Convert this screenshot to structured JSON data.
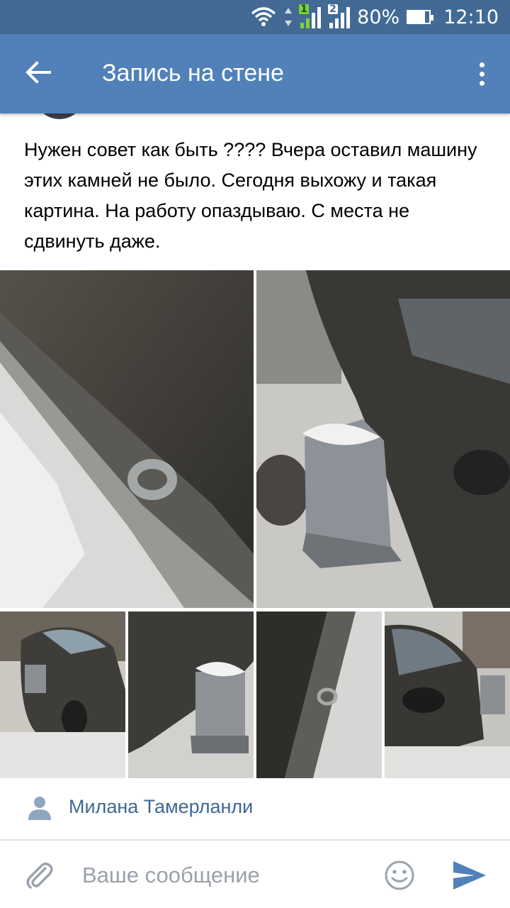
{
  "status_bar": {
    "sim1_label": "1",
    "sim2_label": "2",
    "battery": "80%",
    "time": "12:10"
  },
  "toolbar": {
    "title": "Запись на стене",
    "back_icon": "arrow-back-icon",
    "more_icon": "more-vertical-icon"
  },
  "post": {
    "text": "Нужен совет как быть ???? Вчера оставил машину этих камней не было. Сегодня выхожу и такая картина. На работу опаздываю. С места не сдвинуть даже.",
    "photos_count": 6
  },
  "author": {
    "name": "Милана Тамерланли",
    "icon": "person-icon"
  },
  "composer": {
    "placeholder": "Ваше сообщение",
    "attach_icon": "paperclip-icon",
    "emoji_icon": "smiley-icon",
    "send_icon": "send-icon"
  },
  "colors": {
    "status_bar": "#426a95",
    "toolbar": "#5181b8",
    "link": "#3f6896",
    "send": "#5181b8"
  }
}
